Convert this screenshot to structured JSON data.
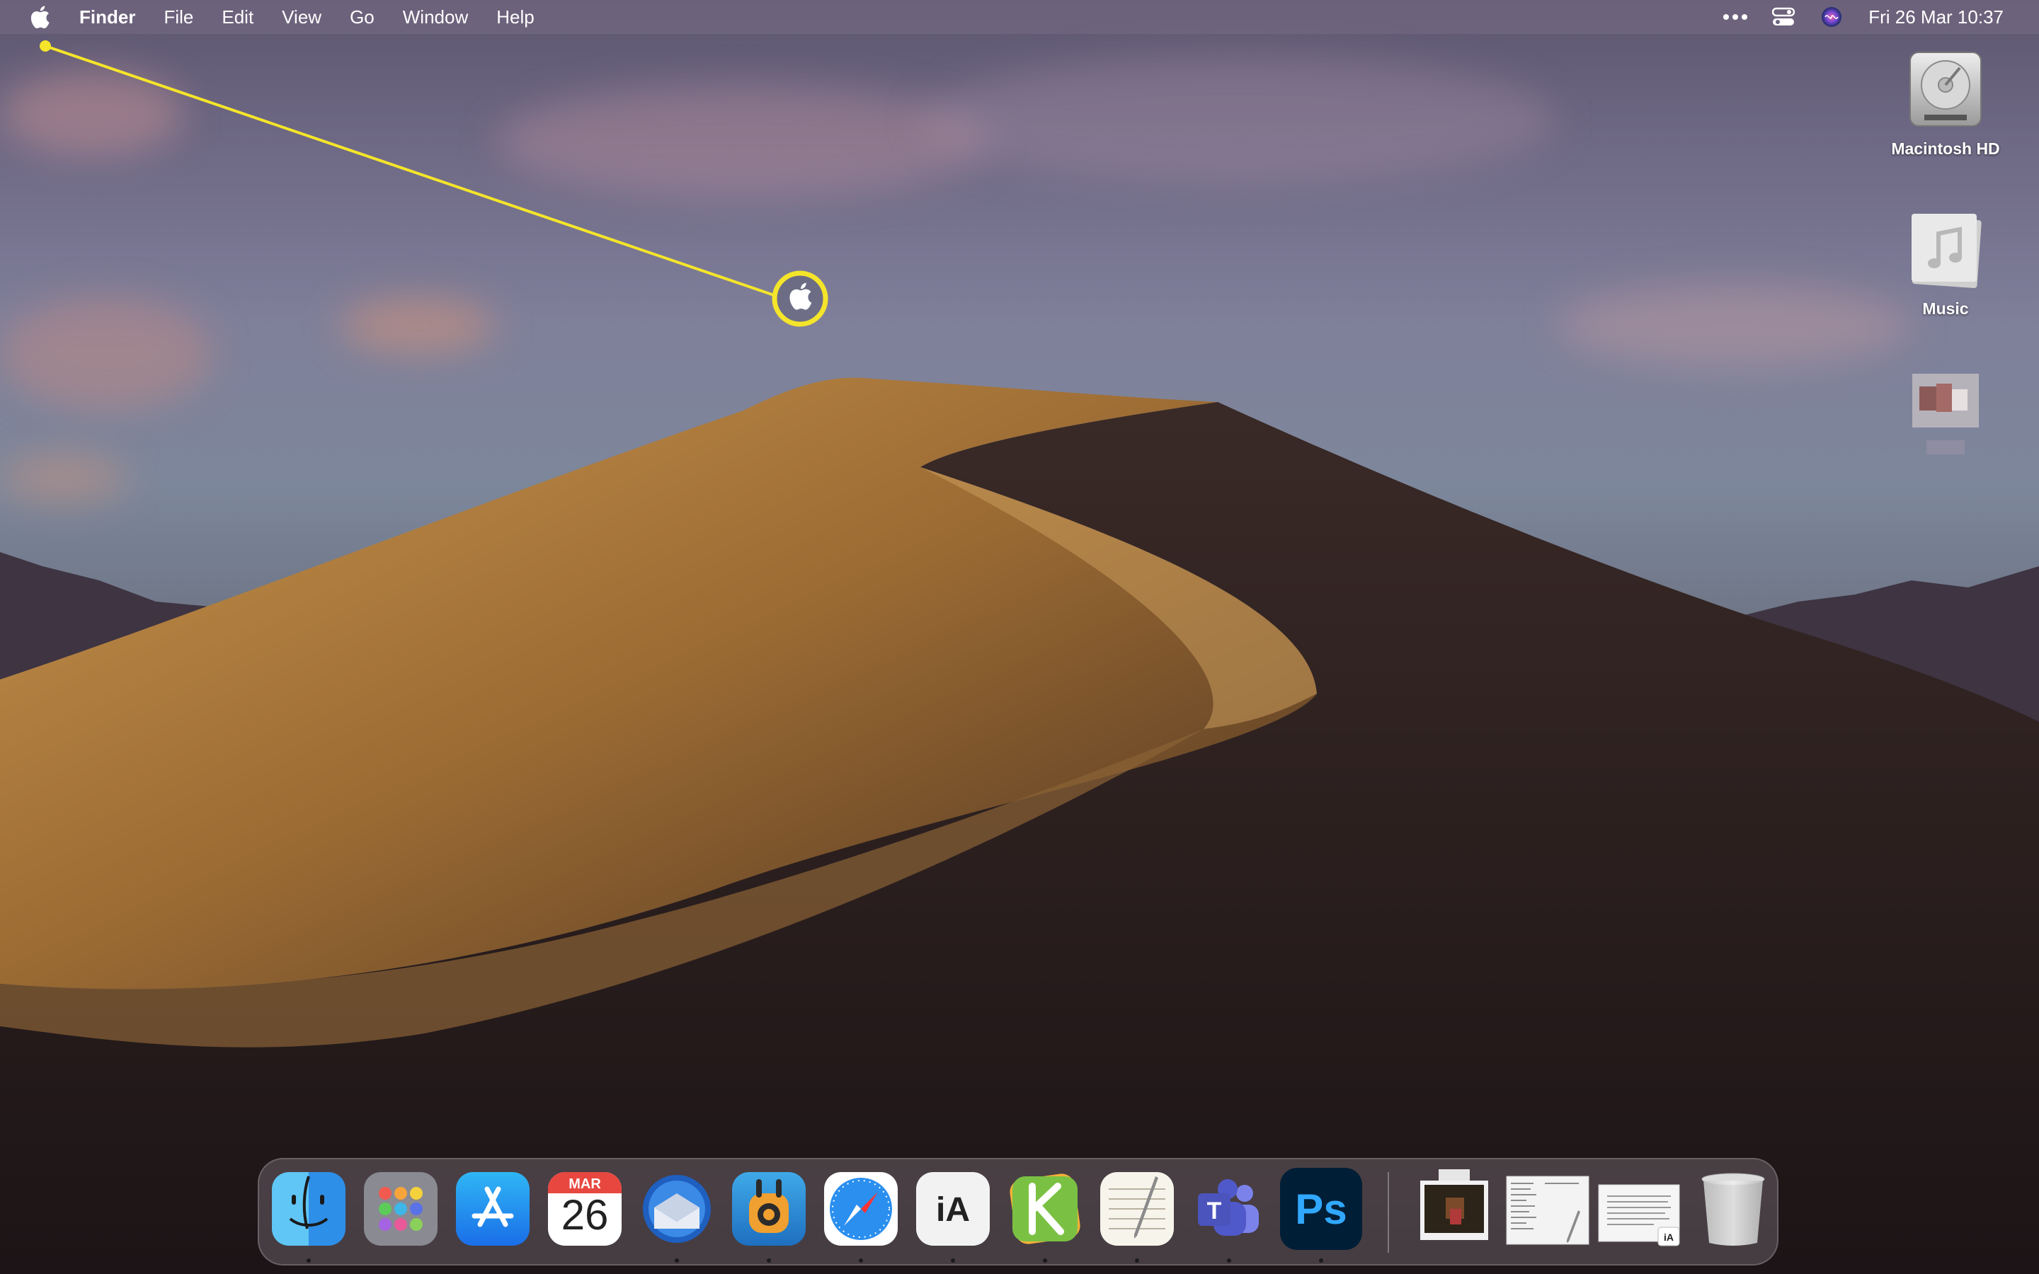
{
  "menubar": {
    "apple_icon": "apple-logo-icon",
    "items": [
      "Finder",
      "File",
      "Edit",
      "View",
      "Go",
      "Window",
      "Help"
    ],
    "status_icons": [
      "more-dots-icon",
      "control-center-icon",
      "siri-icon"
    ],
    "clock": "Fri 26 Mar  10:37"
  },
  "desktop": {
    "icons": [
      {
        "label": "Macintosh HD",
        "icon": "hard-drive-icon"
      },
      {
        "label": "Music",
        "icon": "music-folder-icon"
      },
      {
        "label": "",
        "icon": "blurred-file-icon"
      }
    ]
  },
  "annotation": {
    "color": "#f5e52a",
    "icon": "apple-logo-icon"
  },
  "dock": {
    "apps": [
      {
        "name": "Finder",
        "icon": "finder-icon",
        "running": true
      },
      {
        "name": "Launchpad",
        "icon": "launchpad-icon",
        "running": false
      },
      {
        "name": "App Store",
        "icon": "app-store-icon",
        "running": false
      },
      {
        "name": "Calendar",
        "icon": "calendar-icon",
        "month": "MAR",
        "day": "26",
        "running": false
      },
      {
        "name": "Thunderbird",
        "icon": "thunderbird-icon",
        "running": true
      },
      {
        "name": "Tweetbot",
        "icon": "tweetbot-icon",
        "running": true
      },
      {
        "name": "Safari",
        "icon": "safari-icon",
        "running": true
      },
      {
        "name": "iA Writer",
        "icon": "ia-writer-icon",
        "label": "iA",
        "running": true
      },
      {
        "name": "Kolibri",
        "icon": "k-app-icon",
        "running": true
      },
      {
        "name": "TextEdit",
        "icon": "textedit-icon",
        "running": true
      },
      {
        "name": "Microsoft Teams",
        "icon": "teams-icon",
        "label": "T",
        "running": true
      },
      {
        "name": "Photoshop",
        "icon": "photoshop-icon",
        "label": "Ps",
        "running": true
      }
    ],
    "stack_items": [
      {
        "icon": "photo-thumbnail-icon"
      },
      {
        "icon": "document-thumbnail-icon"
      },
      {
        "icon": "ia-document-thumbnail-icon"
      },
      {
        "icon": "trash-icon"
      }
    ]
  },
  "colors": {
    "menubar_text": "#ffffff",
    "photoshop_blue": "#31a8ff",
    "photoshop_bg": "#001e36",
    "calendar_red": "#e8473f"
  }
}
